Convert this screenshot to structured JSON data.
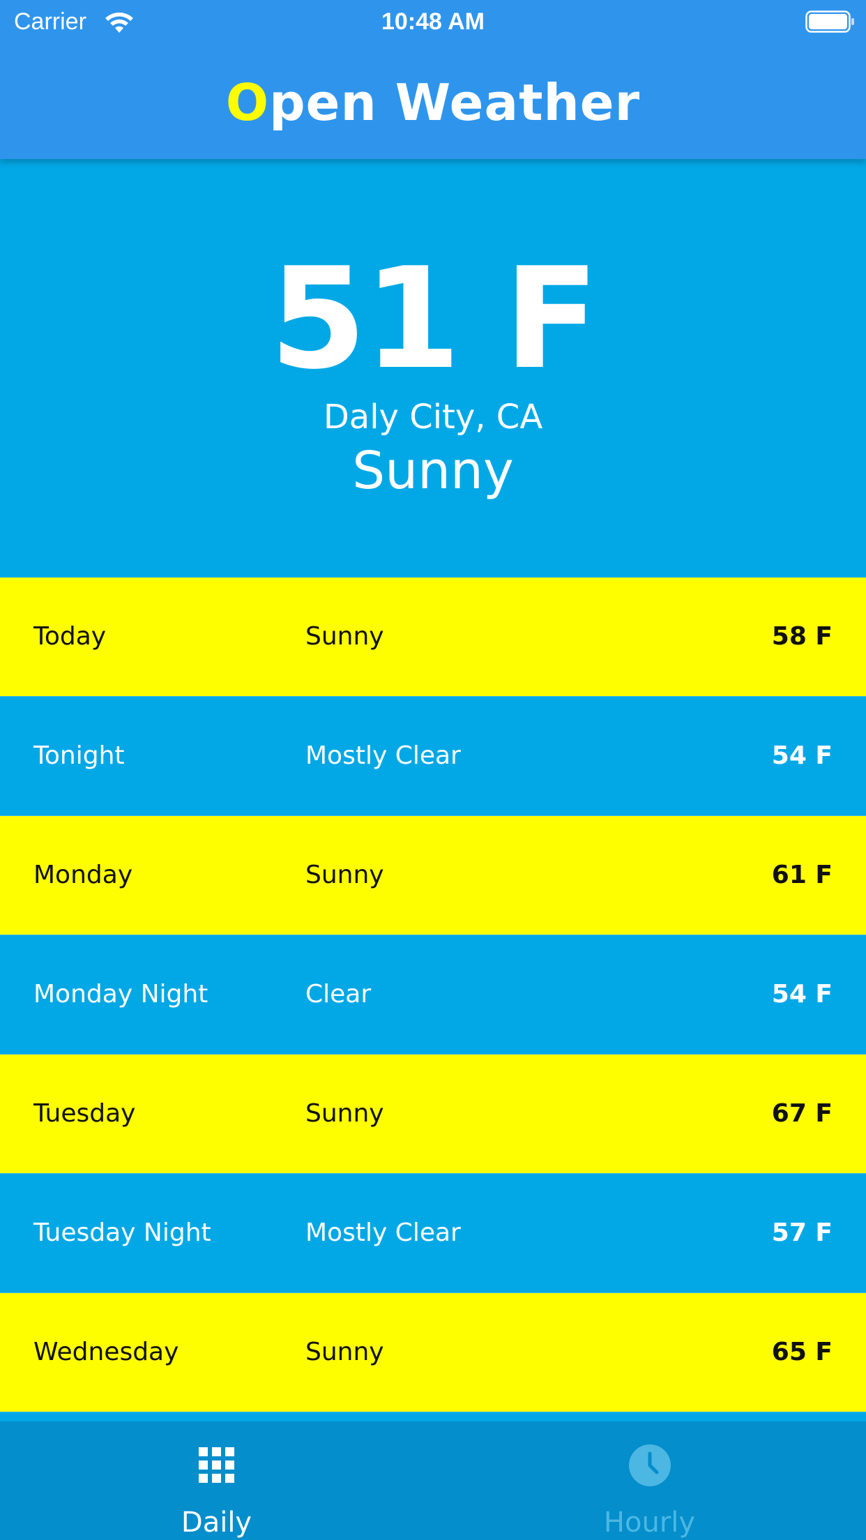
{
  "status_bar": {
    "carrier": "Carrier",
    "time": "10:48 AM"
  },
  "header": {
    "title_first_letter": "O",
    "title_rest": "pen Weather",
    "accent_color": "#fffd00",
    "background_color": "#2f95ec"
  },
  "current": {
    "temperature": "51 F",
    "location": "Daly City, CA",
    "condition": "Sunny"
  },
  "forecast": [
    {
      "day": "Today",
      "condition": "Sunny",
      "temp": "58 F",
      "color": "#fffe00"
    },
    {
      "day": "Tonight",
      "condition": "Mostly Clear",
      "temp": "54 F",
      "color": "#02a8e6"
    },
    {
      "day": "Monday",
      "condition": "Sunny",
      "temp": "61 F",
      "color": "#fffe00"
    },
    {
      "day": "Monday Night",
      "condition": "Clear",
      "temp": "54 F",
      "color": "#02a8e6"
    },
    {
      "day": "Tuesday",
      "condition": "Sunny",
      "temp": "67 F",
      "color": "#fffe00"
    },
    {
      "day": "Tuesday Night",
      "condition": "Mostly Clear",
      "temp": "57 F",
      "color": "#02a8e6"
    },
    {
      "day": "Wednesday",
      "condition": "Sunny",
      "temp": "65 F",
      "color": "#fffe00"
    }
  ],
  "tabs": [
    {
      "label": "Daily",
      "icon": "grid-icon",
      "selected": true
    },
    {
      "label": "Hourly",
      "icon": "clock-icon",
      "selected": false
    }
  ]
}
